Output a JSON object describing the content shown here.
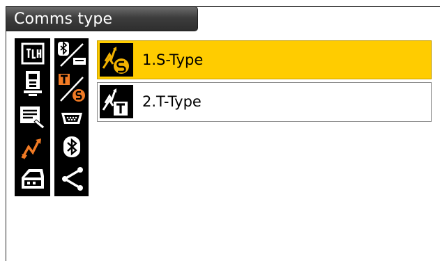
{
  "header": {
    "title": "Comms type"
  },
  "sidebar": {
    "column1": [
      "tilt-icon",
      "instrument-icon",
      "data-icon",
      "comms-icon",
      "memory-icon"
    ],
    "column2": [
      "bluetooth-cable-icon",
      "t-s-type-icon",
      "rs232-port-icon",
      "bluetooth-icon",
      "share-icon"
    ],
    "active": "comms-icon"
  },
  "options": [
    {
      "label": "1.S-Type",
      "icon": "s-type-icon",
      "selected": true
    },
    {
      "label": "2.T-Type",
      "icon": "t-type-icon",
      "selected": false
    }
  ],
  "colors": {
    "selected": "#ffcc00",
    "accent": "#f07a24",
    "title_bg": "#3d3d3d"
  }
}
